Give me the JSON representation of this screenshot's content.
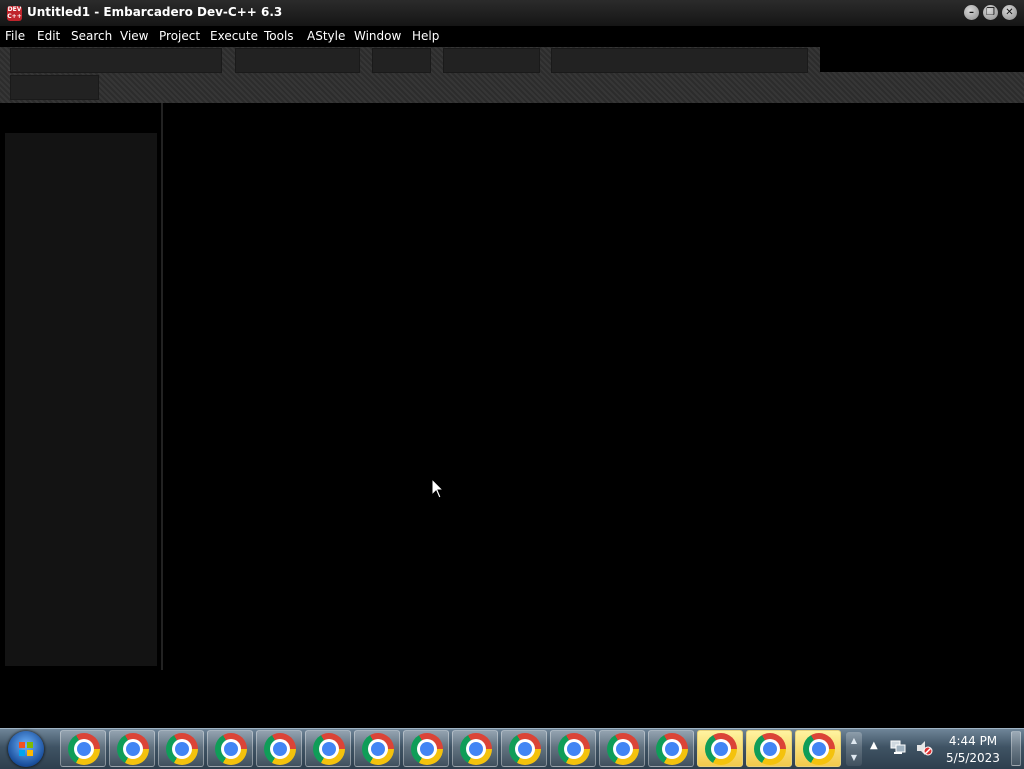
{
  "window": {
    "title": "Untitled1 - Embarcadero Dev-C++ 6.3",
    "icon": "devcpp-app-icon",
    "icon_text": "DEV C++",
    "controls": {
      "minimize": "–",
      "restore": "❐",
      "close": "✕"
    }
  },
  "menu": {
    "items": [
      "File",
      "Edit",
      "Search",
      "View",
      "Project",
      "Execute",
      "Tools",
      "AStyle",
      "Window",
      "Help"
    ]
  },
  "taskbar": {
    "start_icon": "windows-start-orb",
    "chrome_buttons": [
      {
        "active": false
      },
      {
        "active": false
      },
      {
        "active": false
      },
      {
        "active": false
      },
      {
        "active": false
      },
      {
        "active": false
      },
      {
        "active": false
      },
      {
        "active": false
      },
      {
        "active": false
      },
      {
        "active": false
      },
      {
        "active": false
      },
      {
        "active": false
      },
      {
        "active": false
      },
      {
        "active": true
      },
      {
        "active": true
      },
      {
        "active": true
      }
    ],
    "tray": {
      "arrow": "▲",
      "network_icon": "network-icon",
      "volume_icon": "volume-muted-icon"
    },
    "clock": {
      "time": "4:44 PM",
      "date": "5/5/2023"
    }
  },
  "colors": {
    "editor_bg": "#000000",
    "panel_bg": "#131313",
    "taskbar_active": "#f2c94c"
  }
}
